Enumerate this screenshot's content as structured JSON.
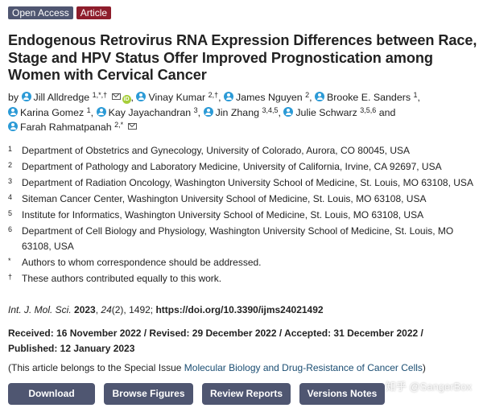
{
  "badges": {
    "open_access": "Open Access",
    "article": "Article"
  },
  "title": "Endogenous Retrovirus RNA Expression Differences between Race, Stage and HPV Status Offer Improved Prognostication among Women with Cervical Cancer",
  "authors": {
    "by": "by",
    "list": [
      {
        "name": "Jill Alldredge",
        "sup": "1,*,†"
      },
      {
        "name": "Vinay Kumar",
        "sup": "2,†"
      },
      {
        "name": "James Nguyen",
        "sup": "2"
      },
      {
        "name": "Brooke E. Sanders",
        "sup": "1"
      },
      {
        "name": "Karina Gomez",
        "sup": "1"
      },
      {
        "name": "Kay Jayachandran",
        "sup": "3"
      },
      {
        "name": "Jin Zhang",
        "sup": "3,4,5"
      },
      {
        "name": "Julie Schwarz",
        "sup": "3,5,6"
      },
      {
        "name": "Farah Rahmatpanah",
        "sup": "2,*"
      }
    ],
    "and": "and"
  },
  "affiliations": [
    {
      "num": "1",
      "text": "Department of Obstetrics and Gynecology, University of Colorado, Aurora, CO 80045, USA"
    },
    {
      "num": "2",
      "text": "Department of Pathology and Laboratory Medicine, University of California, Irvine, CA 92697, USA"
    },
    {
      "num": "3",
      "text": "Department of Radiation Oncology, Washington University School of Medicine, St. Louis, MO 63108, USA"
    },
    {
      "num": "4",
      "text": "Siteman Cancer Center, Washington University School of Medicine, St. Louis, MO 63108, USA"
    },
    {
      "num": "5",
      "text": "Institute for Informatics, Washington University School of Medicine, St. Louis, MO 63108, USA"
    },
    {
      "num": "6",
      "text": "Department of Cell Biology and Physiology, Washington University School of Medicine, St. Louis, MO 63108, USA"
    },
    {
      "num": "*",
      "text": "Authors to whom correspondence should be addressed."
    },
    {
      "num": "†",
      "text": "These authors contributed equally to this work."
    }
  ],
  "citation": {
    "journal": "Int. J. Mol. Sci.",
    "year": "2023",
    "volume": "24",
    "issue": "(2), 1492; ",
    "doi": "https://doi.org/10.3390/ijms24021492"
  },
  "dates": {
    "line1": "Received: 16 November 2022 / Revised: 29 December 2022 / Accepted: 31 December 2022 /",
    "line2": "Published: 12 January 2023"
  },
  "special_issue": {
    "prefix": "(This article belongs to the Special Issue ",
    "name": "Molecular Biology and Drug-Resistance of Cancer Cells",
    "suffix": ")"
  },
  "buttons": {
    "download": "Download",
    "browse_figures": "Browse Figures",
    "review_reports": "Review Reports",
    "versions_notes": "Versions Notes"
  },
  "watermark": "知乎 @SangerBox",
  "colors": {
    "button_bg": "#4f5671",
    "article_badge": "#8e1d2b",
    "person_icon": "#2b9ad6",
    "orcid": "#a6ce39"
  }
}
